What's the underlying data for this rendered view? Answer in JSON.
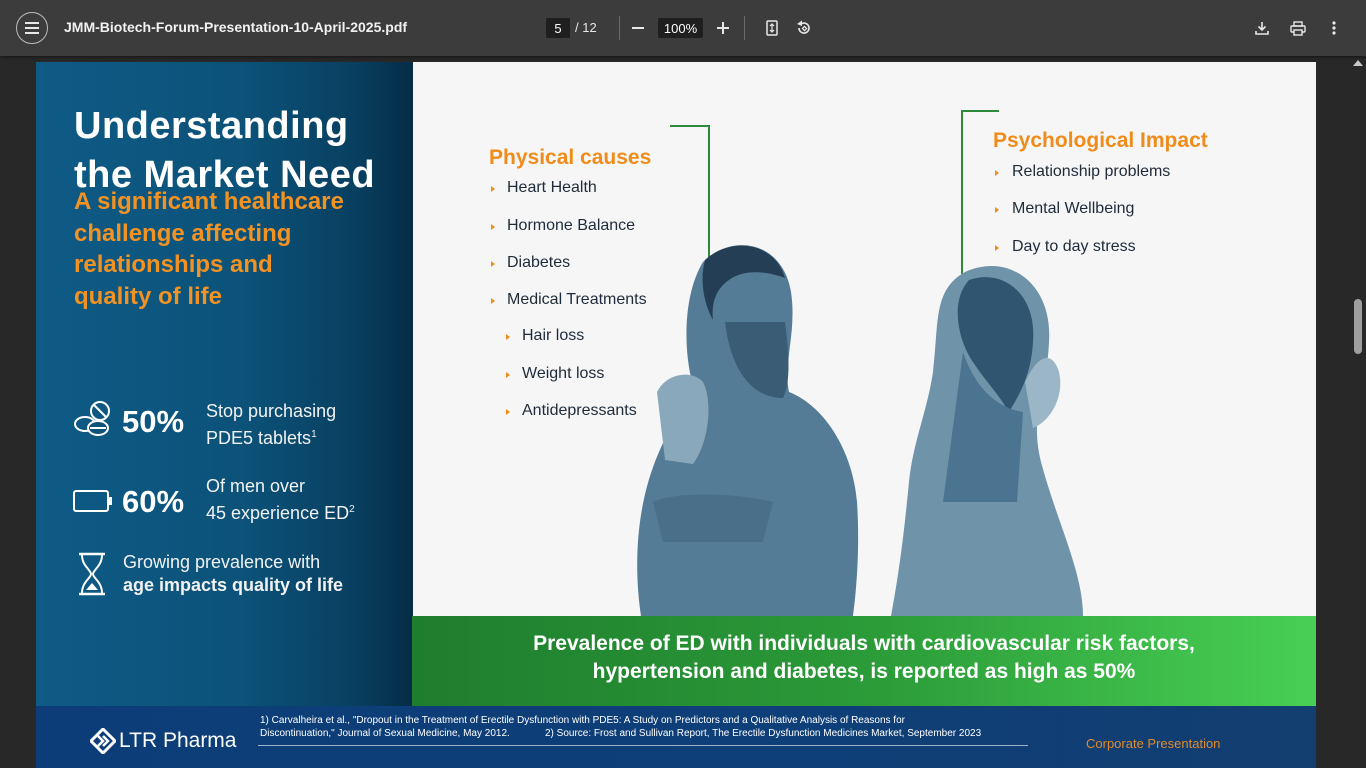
{
  "viewer": {
    "title": "JMM-Biotech-Forum-Presentation-10-April-2025.pdf",
    "current_page": "5",
    "page_total": "/ 12",
    "zoom": "100%"
  },
  "slide": {
    "heading_line1": "Understanding",
    "heading_line2": "the Market Need",
    "subheading": [
      "A significant healthcare",
      "challenge affecting",
      "relationships and",
      "quality of life"
    ],
    "stats": [
      {
        "number": "50%",
        "line1": "Stop purchasing",
        "line2": "PDE5 tablets",
        "sup": "1"
      },
      {
        "number": "60%",
        "line1": "Of men over",
        "line2": "45 experience ED",
        "sup": "2"
      },
      {
        "line1": "Growing prevalence with",
        "line2": "age impacts quality of life"
      }
    ],
    "physical": {
      "title": "Physical causes",
      "items": [
        "Heart Health",
        "Hormone Balance",
        "Diabetes",
        "Medical Treatments"
      ],
      "subitems": [
        "Hair loss",
        "Weight loss",
        "Antidepressants"
      ]
    },
    "psychological": {
      "title": "Psychological Impact",
      "items": [
        "Relationship problems",
        "Mental Wellbeing",
        "Day to day stress"
      ]
    },
    "band_line1": "Prevalence of ED with individuals with cardiovascular risk factors,",
    "band_line2_a": "hypertension and diabetes,",
    "band_line2_b": "is reported as high as 50%",
    "footer": {
      "logo": "LTR Pharma",
      "ref1_line1": "1) Carvalheira et al., \"Dropout in the Treatment of Erectile Dysfunction with PDE5: A Study on Predictors and a Qualitative Analysis of Reasons for",
      "ref1_line2": "Discontinuation,\" Journal of Sexual Medicine, May 2012.",
      "ref2": "2) Source: Frost and Sullivan Report, The Erectile Dysfunction Medicines Market, September 2023",
      "corporate": "Corporate Presentation"
    }
  }
}
